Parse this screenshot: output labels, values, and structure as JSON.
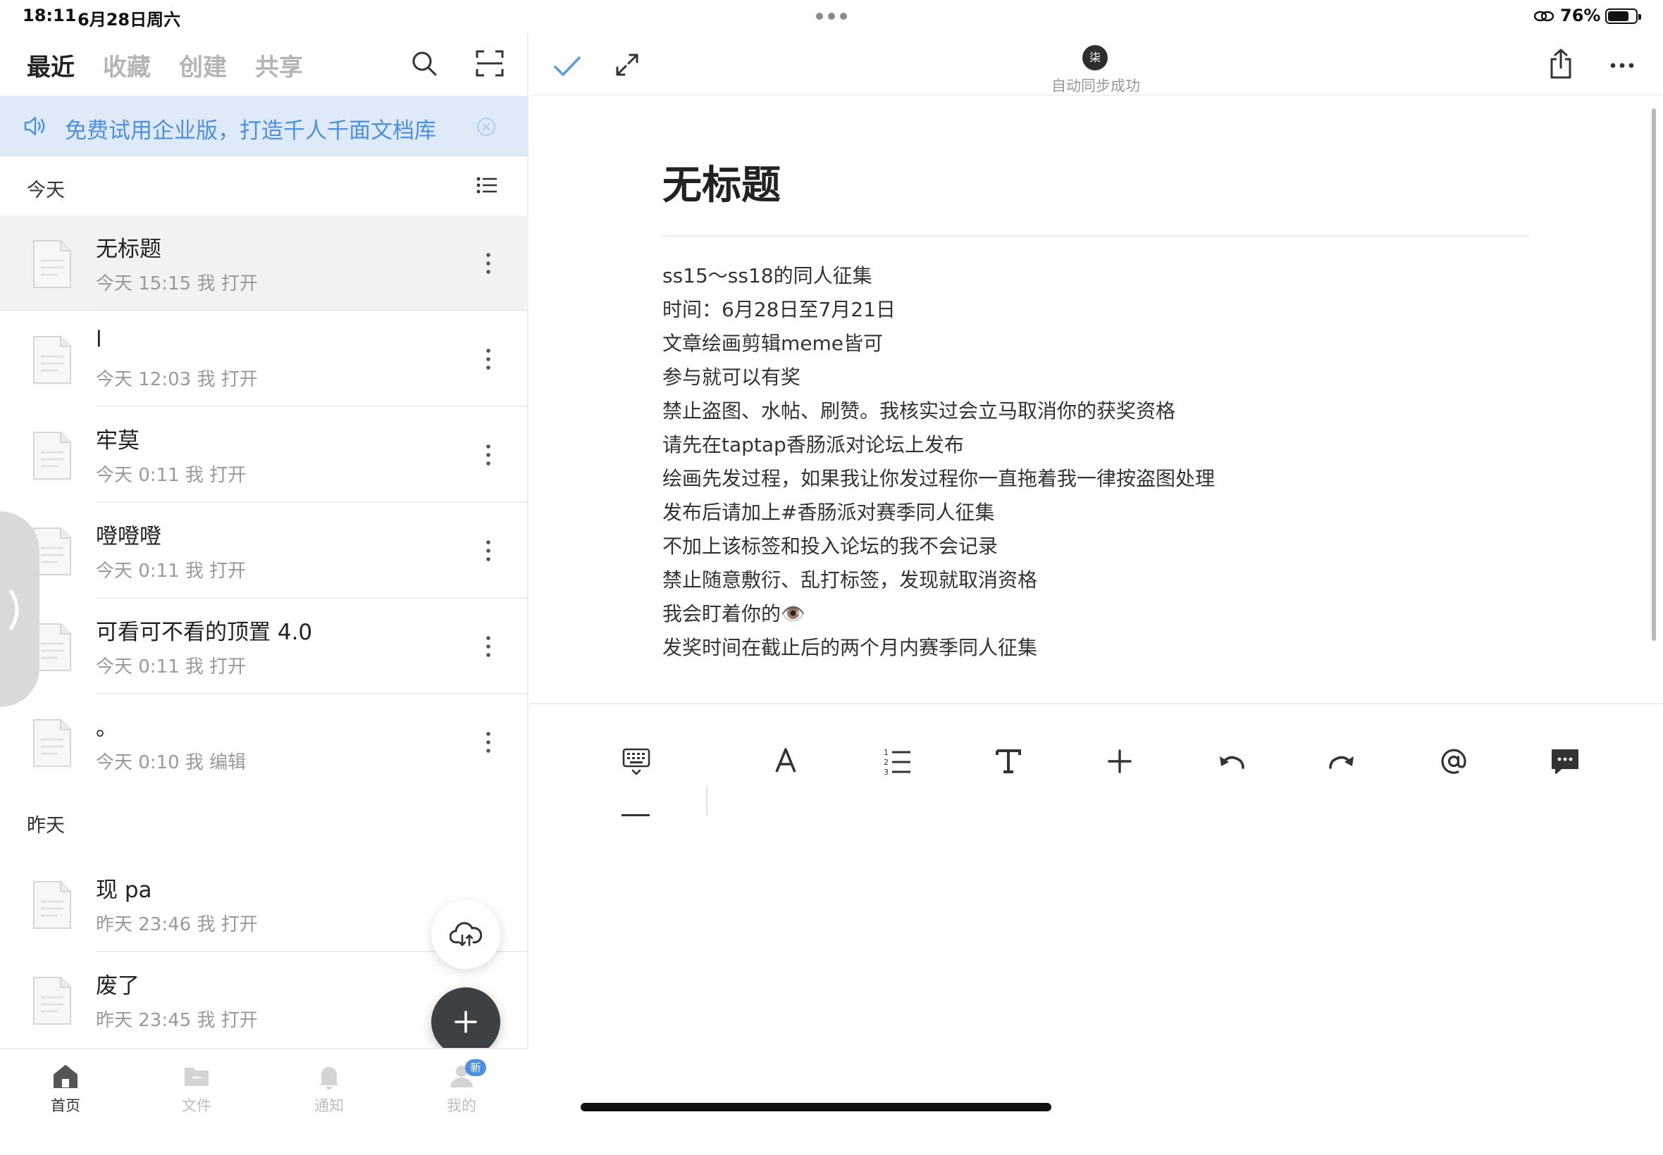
{
  "status_bar": {
    "time": "18:11",
    "date": "6月28日周六",
    "battery_percent": "76%",
    "battery_level": 0.76
  },
  "left": {
    "tabs": [
      {
        "label": "最近",
        "active": true
      },
      {
        "label": "收藏",
        "active": false
      },
      {
        "label": "创建",
        "active": false
      },
      {
        "label": "共享",
        "active": false
      }
    ],
    "banner_text": "免费试用企业版，打造千人千面文档库",
    "section_today": "今天",
    "section_yesterday": "昨天",
    "docs_today": [
      {
        "title": "无标题",
        "meta": "今天 15:15 我 打开"
      },
      {
        "title": "l",
        "meta": "今天 12:03 我 打开"
      },
      {
        "title": "牢莫",
        "meta": "今天 0:11 我 打开"
      },
      {
        "title": "噔噔噔",
        "meta": "今天 0:11 我 打开"
      },
      {
        "title": "可看可不看的顶置 4.0",
        "meta": "今天 0:11 我 打开"
      },
      {
        "title": "。",
        "meta": "今天 0:10 我 编辑"
      }
    ],
    "docs_yesterday": [
      {
        "title": "现 pa",
        "meta": "昨天 23:46 我 打开"
      },
      {
        "title": "废了",
        "meta": "昨天 23:45 我 打开"
      }
    ],
    "tabbar": [
      {
        "label": "首页"
      },
      {
        "label": "文件"
      },
      {
        "label": "通知"
      },
      {
        "label": "我的",
        "badge": "新"
      }
    ]
  },
  "right": {
    "avatar_text": "柒",
    "sync_status": "自动同步成功",
    "doc_title": "无标题",
    "doc_lines": [
      "ss15～ss18的同人征集",
      "时间：6月28日至7月21日",
      "文章绘画剪辑meme皆可",
      "参与就可以有奖",
      "禁止盗图、水帖、刷赞。我核实过会立马取消你的获奖资格",
      "请先在taptap香肠派对论坛上发布",
      "绘画先发过程，如果我让你发过程你一直拖着我一律按盗图处理",
      "发布后请加上#香肠派对赛季同人征集",
      "不加上该标签和投入论坛的我不会记录",
      "禁止随意敷衍、乱打标签，发现就取消资格",
      "我会盯着你的👁️",
      "发奖时间在截止后的两个月内赛季同人征集"
    ]
  },
  "colors": {
    "accent_blue": "#4d8fe0",
    "banner_bg": "#deeaf8",
    "check_blue": "#5b9be6",
    "selected_row": "#f2f2f2",
    "fab_dark": "#3d4143"
  }
}
